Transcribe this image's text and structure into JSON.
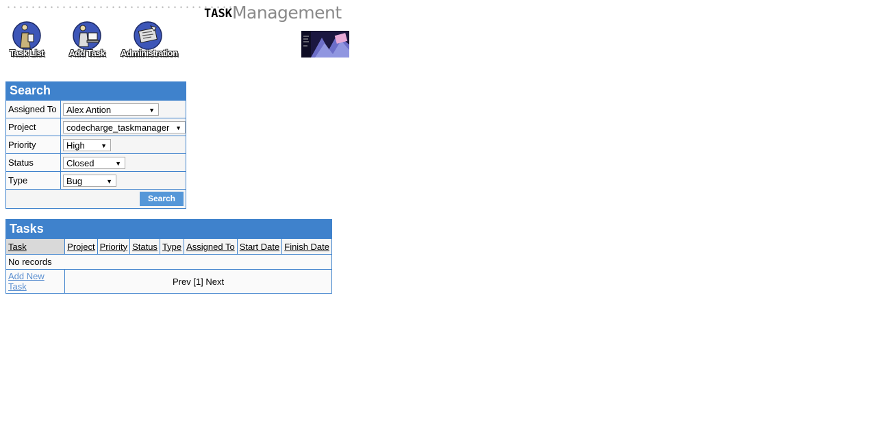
{
  "header": {
    "logo_task": "TASK",
    "logo_management": "Management",
    "nav": [
      {
        "label": "Task List",
        "icon": "task-list-icon"
      },
      {
        "label": "Add Task",
        "icon": "add-task-icon"
      },
      {
        "label": "Administration",
        "icon": "administration-icon"
      }
    ]
  },
  "search": {
    "title": "Search",
    "fields": [
      {
        "label": "Assigned To",
        "value": "Alex Antion"
      },
      {
        "label": "Project",
        "value": "codecharge_taskmanager"
      },
      {
        "label": "Priority",
        "value": "High"
      },
      {
        "label": "Status",
        "value": "Closed"
      },
      {
        "label": "Type",
        "value": "Bug"
      }
    ],
    "button": "Search"
  },
  "tasks": {
    "title": "Tasks",
    "columns": [
      "Task",
      "Project",
      "Priority",
      "Status",
      "Type",
      "Assigned To",
      "Start Date",
      "Finish Date"
    ],
    "empty_text": "No records",
    "add_link": "Add New Task",
    "pager": "Prev [1] Next"
  },
  "colors": {
    "panel_header": "#3f82cc",
    "button": "#5597d8",
    "link": "#5b8fd0"
  }
}
